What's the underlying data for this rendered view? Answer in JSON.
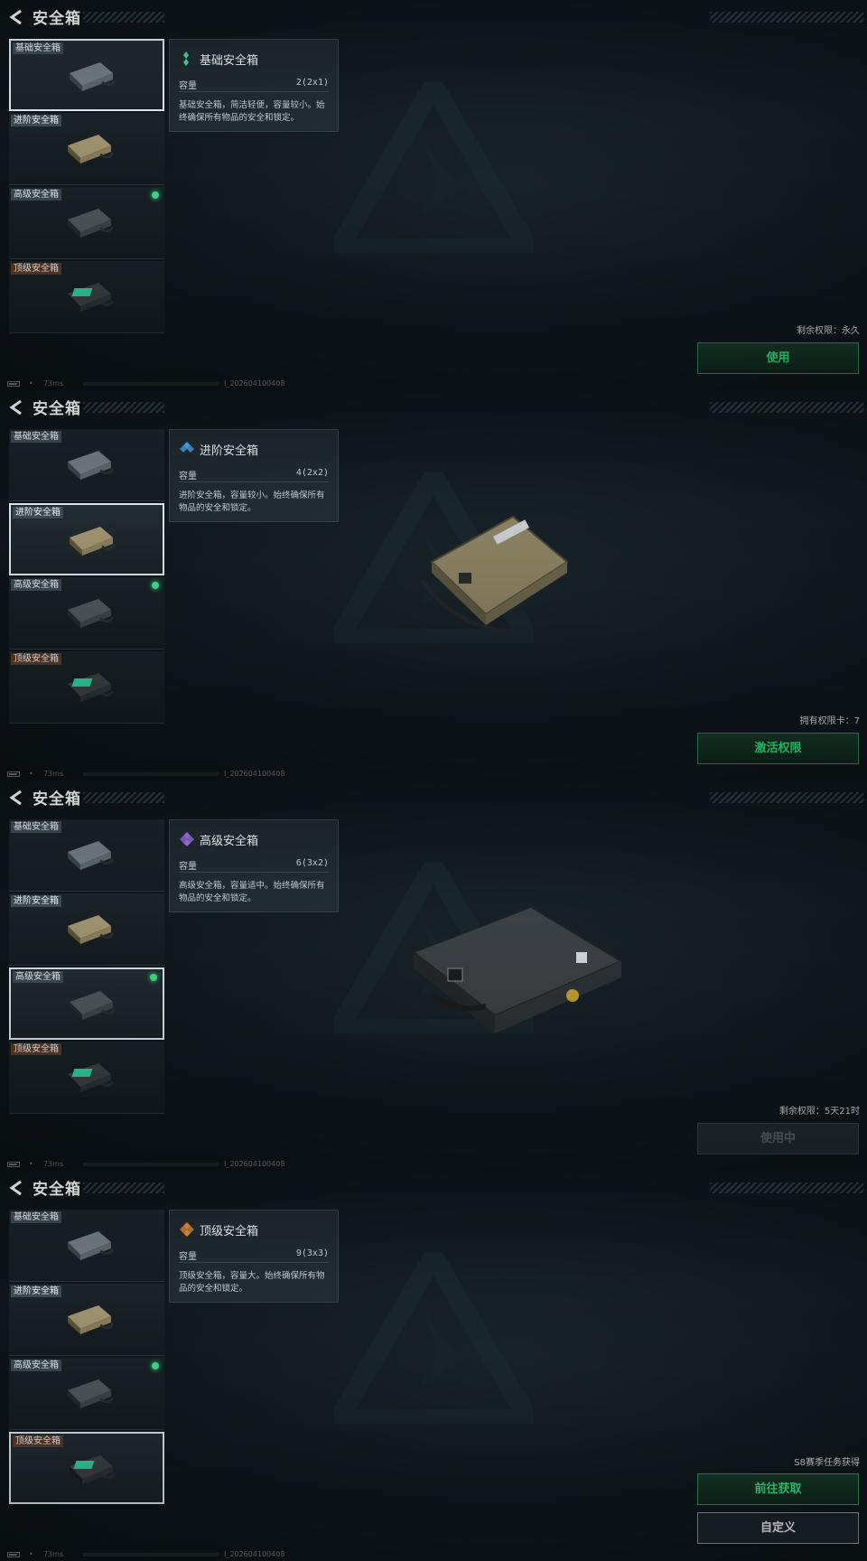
{
  "title": "安全箱",
  "slots": [
    "基础安全箱",
    "进阶安全箱",
    "高级安全箱",
    "顶级安全箱"
  ],
  "capacity_label": "容量",
  "footer": {
    "ping": "73ms",
    "build": "I_202604100408"
  },
  "panels": [
    {
      "selected": 0,
      "name": "基础安全箱",
      "capacity": "2(2x1)",
      "desc": "基础安全箱，简洁轻便，容量较小。始终确保所有物品的安全和锁定。",
      "status": "剩余权限：永久",
      "buttons": [
        "使用"
      ],
      "icon_color": "#3fd3a0"
    },
    {
      "selected": 1,
      "name": "进阶安全箱",
      "capacity": "4(2x2)",
      "desc": "进阶安全箱，容量较小。始终确保所有物品的安全和锁定。",
      "status": "拥有权限卡：7",
      "buttons": [
        "激活权限"
      ],
      "icon_color": "#4aa3e8"
    },
    {
      "selected": 2,
      "name": "高级安全箱",
      "capacity": "6(3x2)",
      "desc": "高级安全箱，容量适中。始终确保所有物品的安全和锁定。",
      "status": "剩余权限：5天21时",
      "buttons": [
        "使用中"
      ],
      "icon_color": "#9a6ee0"
    },
    {
      "selected": 3,
      "name": "顶级安全箱",
      "capacity": "9(3x3)",
      "desc": "顶级安全箱，容量大。始终确保所有物品的安全和锁定。",
      "status": "S8赛季任务获得",
      "buttons": [
        "前往获取",
        "自定义"
      ],
      "icon_color": "#e08a3a"
    }
  ],
  "active_dot_slot": 2
}
